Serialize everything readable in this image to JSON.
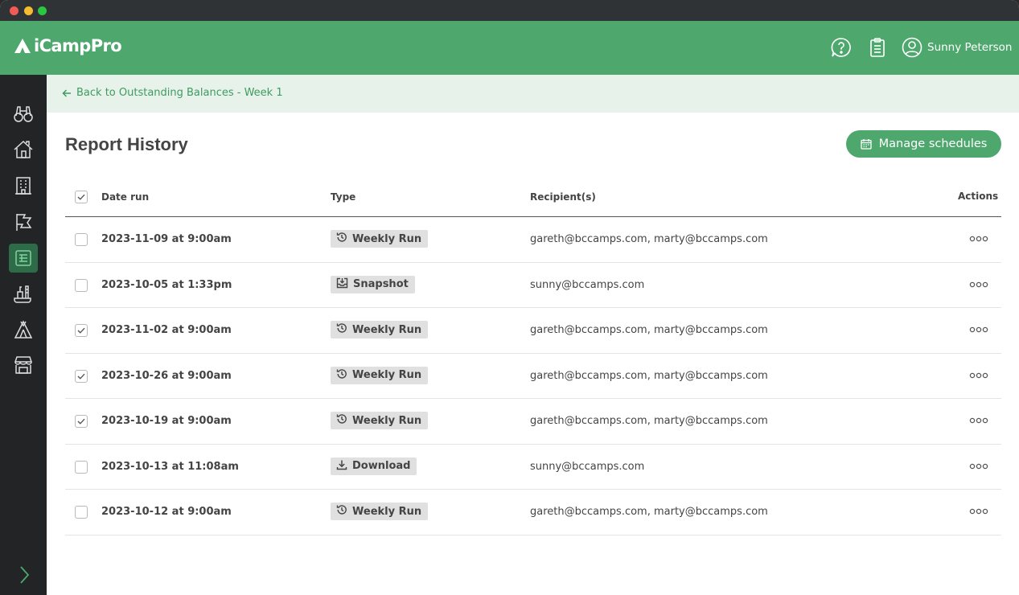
{
  "app": {
    "name": "iCampPro"
  },
  "header": {
    "user_name": "Sunny Peterson"
  },
  "breadcrumb": {
    "back_label": "Back to Outstanding Balances - Week 1"
  },
  "page": {
    "title": "Report History",
    "manage_button": "Manage schedules"
  },
  "table": {
    "columns": {
      "date": "Date run",
      "type": "Type",
      "recipients": "Recipient(s)",
      "actions": "Actions"
    },
    "rows": [
      {
        "date": "2023-11-09 at 9:00am",
        "type": "Weekly Run",
        "type_icon": "history-icon",
        "recipients": "gareth@bccamps.com, marty@bccamps.com",
        "checked": false
      },
      {
        "date": "2023-10-05 at 1:33pm",
        "type": "Snapshot",
        "type_icon": "snapshot-icon",
        "recipients": "sunny@bccamps.com",
        "checked": false
      },
      {
        "date": "2023-11-02 at 9:00am",
        "type": "Weekly Run",
        "type_icon": "history-icon",
        "recipients": "gareth@bccamps.com, marty@bccamps.com",
        "checked": true
      },
      {
        "date": "2023-10-26 at 9:00am",
        "type": "Weekly Run",
        "type_icon": "history-icon",
        "recipients": "gareth@bccamps.com, marty@bccamps.com",
        "checked": true
      },
      {
        "date": "2023-10-19 at 9:00am",
        "type": "Weekly Run",
        "type_icon": "history-icon",
        "recipients": "gareth@bccamps.com, marty@bccamps.com",
        "checked": true
      },
      {
        "date": "2023-10-13 at 11:08am",
        "type": "Download",
        "type_icon": "download-icon",
        "recipients": "sunny@bccamps.com",
        "checked": false
      },
      {
        "date": "2023-10-12 at 9:00am",
        "type": "Weekly Run",
        "type_icon": "history-icon",
        "recipients": "gareth@bccamps.com, marty@bccamps.com",
        "checked": false
      }
    ]
  },
  "sidebar": {
    "items": [
      {
        "icon": "binoculars-icon",
        "active": false
      },
      {
        "icon": "home-icon",
        "active": false
      },
      {
        "icon": "building-icon",
        "active": false
      },
      {
        "icon": "flag-icon",
        "active": false
      },
      {
        "icon": "reports-icon",
        "active": true
      },
      {
        "icon": "supplies-icon",
        "active": false
      },
      {
        "icon": "tent-icon",
        "active": false
      },
      {
        "icon": "store-icon",
        "active": false
      }
    ]
  },
  "colors": {
    "brand": "#4ea86e",
    "brand_light": "#e7f3ea",
    "sidebar": "#222426"
  }
}
